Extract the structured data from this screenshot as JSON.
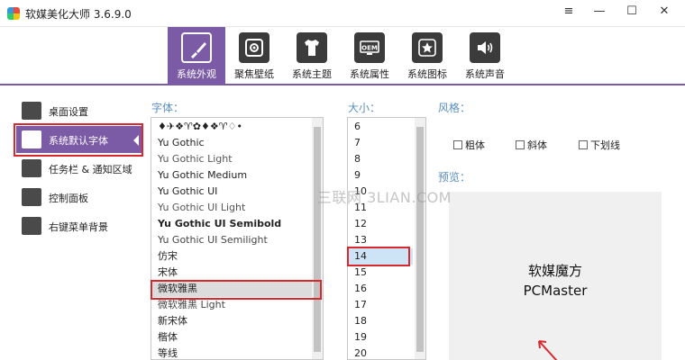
{
  "window": {
    "title": "软媒美化大师 3.6.9.0",
    "menu_glyph": "≡",
    "min_glyph": "—",
    "max_glyph": "☐",
    "close_glyph": "✕"
  },
  "toolbar": {
    "tabs": [
      {
        "label": "系统外观",
        "icon": "brush-icon",
        "active": true
      },
      {
        "label": "聚焦壁纸",
        "icon": "focus-icon",
        "active": false
      },
      {
        "label": "系统主题",
        "icon": "tshirt-icon",
        "active": false
      },
      {
        "label": "系统属性",
        "icon": "oem-icon",
        "active": false
      },
      {
        "label": "系统图标",
        "icon": "star-icon",
        "active": false
      },
      {
        "label": "系统声音",
        "icon": "speaker-icon",
        "active": false
      }
    ]
  },
  "sidebar": {
    "items": [
      {
        "label": "桌面设置",
        "icon": "wrench-icon"
      },
      {
        "label": "系统默认字体",
        "icon": "font-icon",
        "active": true
      },
      {
        "label": "任务栏 & 通知区域",
        "icon": "taskbar-icon"
      },
      {
        "label": "控制面板",
        "icon": "search-panel-icon"
      },
      {
        "label": "右键菜单背景",
        "icon": "menu-bg-icon"
      }
    ]
  },
  "font_section": {
    "label": "字体：",
    "fonts": [
      "♦✈❖♈✿♦❖♈♢•",
      "Yu Gothic",
      "Yu Gothic Light",
      "Yu Gothic Medium",
      "Yu Gothic UI",
      "Yu Gothic UI Light",
      "Yu Gothic UI Semibold",
      "Yu Gothic UI Semilight",
      "仿宋",
      "宋体",
      "微软雅黑",
      "微软雅黑 Light",
      "新宋体",
      "楷体",
      "等线"
    ],
    "selected_index": 10
  },
  "size_section": {
    "label": "大小：",
    "sizes": [
      "6",
      "7",
      "8",
      "9",
      "10",
      "11",
      "12",
      "13",
      "14",
      "15",
      "16",
      "17",
      "18",
      "19",
      "20"
    ],
    "selected_index": 8
  },
  "style_section": {
    "label": "风格：",
    "options": [
      "粗体",
      "斜体",
      "下划线"
    ]
  },
  "preview_section": {
    "label": "预览：",
    "line1": "软媒魔方",
    "line2": "PCMaster"
  },
  "watermark": "三联网 3LIAN.COM",
  "colors": {
    "accent": "#7b5aa6",
    "highlight_red": "#d9272e",
    "label_blue": "#5a8fc4",
    "size_selected": "#cde4f7"
  }
}
